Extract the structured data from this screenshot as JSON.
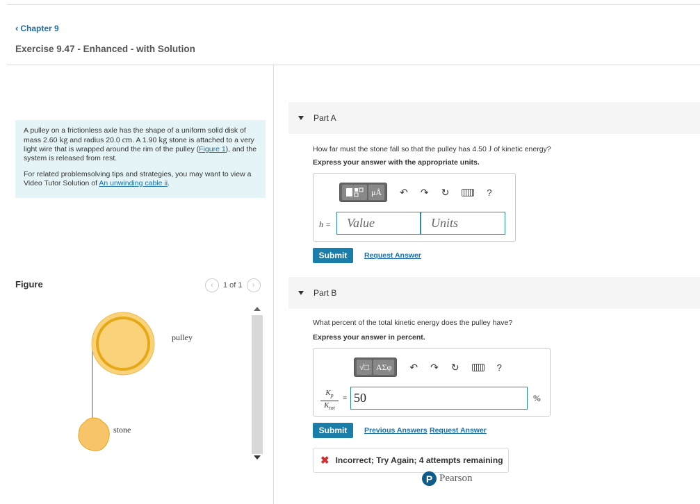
{
  "nav": {
    "chapter_link": "Chapter 9",
    "exercise_title": "Exercise 9.47 - Enhanced - with Solution"
  },
  "problem": {
    "text_1": "A pulley on a frictionless axle has the shape of a uniform solid disk of mass 2.60",
    "unit_kg_1": "kg",
    "text_2": "and radius 20.0",
    "unit_cm": "cm",
    "text_3": ". A 1.90",
    "unit_kg_2": "kg",
    "text_4": "stone is attached to a very light wire that is wrapped around the rim of the pulley (",
    "figure_link": "Figure 1",
    "text_5": "), and the system is released from rest.",
    "tips_text": "For related problemsolving tips and strategies, you may want to view a Video Tutor Solution of",
    "tips_link": "An unwinding cable ii",
    "tips_end": "."
  },
  "figure": {
    "label": "Figure",
    "pager": "1 of 1",
    "pulley_label": "pulley",
    "stone_label": "stone",
    "colors": {
      "pulley_fill": "#f9d27a",
      "pulley_rim": "#e6a817",
      "stone_fill": "#f7c46a",
      "wire": "#777777"
    }
  },
  "part_a": {
    "header": "Part A",
    "question_1": "How far must the stone fall so that the pulley has 4.50",
    "question_unit": "J",
    "question_2": "of kinetic energy?",
    "instruction": "Express your answer with the appropriate units.",
    "toolbar_units_glyph": "μÅ",
    "variable": "h =",
    "value_placeholder": "Value",
    "units_placeholder": "Units",
    "help": "?",
    "submit": "Submit",
    "request_answer": "Request Answer"
  },
  "part_b": {
    "header": "Part B",
    "question": "What percent of the total kinetic energy does the pulley have?",
    "instruction": "Express your answer in percent.",
    "toolbar_sqrt_glyph": "√□",
    "toolbar_greek_glyph": "ΑΣφ",
    "help": "?",
    "frac_num": "K",
    "frac_num_sub": "p",
    "frac_den": "K",
    "frac_den_sub": "tot",
    "equals": "=",
    "answer_value": "50",
    "unit": "%",
    "submit": "Submit",
    "previous_answers": "Previous Answers",
    "request_answer": "Request Answer",
    "feedback": "Incorrect; Try Again; 4 attempts remaining"
  },
  "footer": {
    "brand": "Pearson",
    "logo_letter": "P"
  },
  "colors": {
    "accent": "#1a7ea8",
    "problem_bg": "#e5f4f7",
    "incorrect": "#d32f2f"
  }
}
